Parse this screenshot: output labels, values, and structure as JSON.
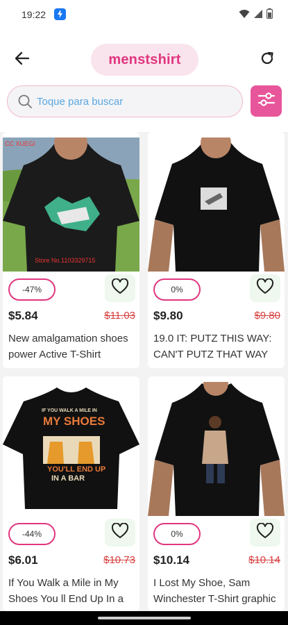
{
  "status_bar": {
    "time": "19:22",
    "icons": [
      "messenger-icon",
      "wifi-icon",
      "signal-icon",
      "battery-icon"
    ]
  },
  "header": {
    "title": "menstshirt",
    "back_icon": "arrow-left-icon",
    "refresh_icon": "refresh-icon"
  },
  "search": {
    "placeholder": "Toque para buscar",
    "filter_icon": "sliders-icon"
  },
  "products": [
    {
      "discount": "-47%",
      "price": "$5.84",
      "old_price": "$11.03",
      "name": "New amalgamation shoes power Active T-Shirt",
      "image_overlay_top": "CC XUEGI",
      "image_overlay_bottom": "Store No.1103329715"
    },
    {
      "discount": "0%",
      "price": "$9.80",
      "old_price": "$9.80",
      "name": "19.0 IT: PUTZ THIS WAY: CAN'T PUTZ THAT WAY"
    },
    {
      "discount": "-44%",
      "price": "$6.01",
      "old_price": "$10.73",
      "name": "If You Walk a Mile in My Shoes You ll End Up In a Bar",
      "shirt_text_1": "IF YOU WALK A MILE IN",
      "shirt_text_2": "MY SHOES",
      "shirt_text_3": "YOU'LL END UP",
      "shirt_text_4": "IN A BAR"
    },
    {
      "discount": "0%",
      "price": "$10.14",
      "old_price": "$10.14",
      "name": "I Lost My Shoe, Sam Winchester T-Shirt graphic"
    }
  ],
  "colors": {
    "accent": "#e0367f",
    "filter_button": "#e7559a",
    "title_pill": "#f9e3ed",
    "old_price": "#d84040",
    "heart_bg": "#eef8ee"
  }
}
